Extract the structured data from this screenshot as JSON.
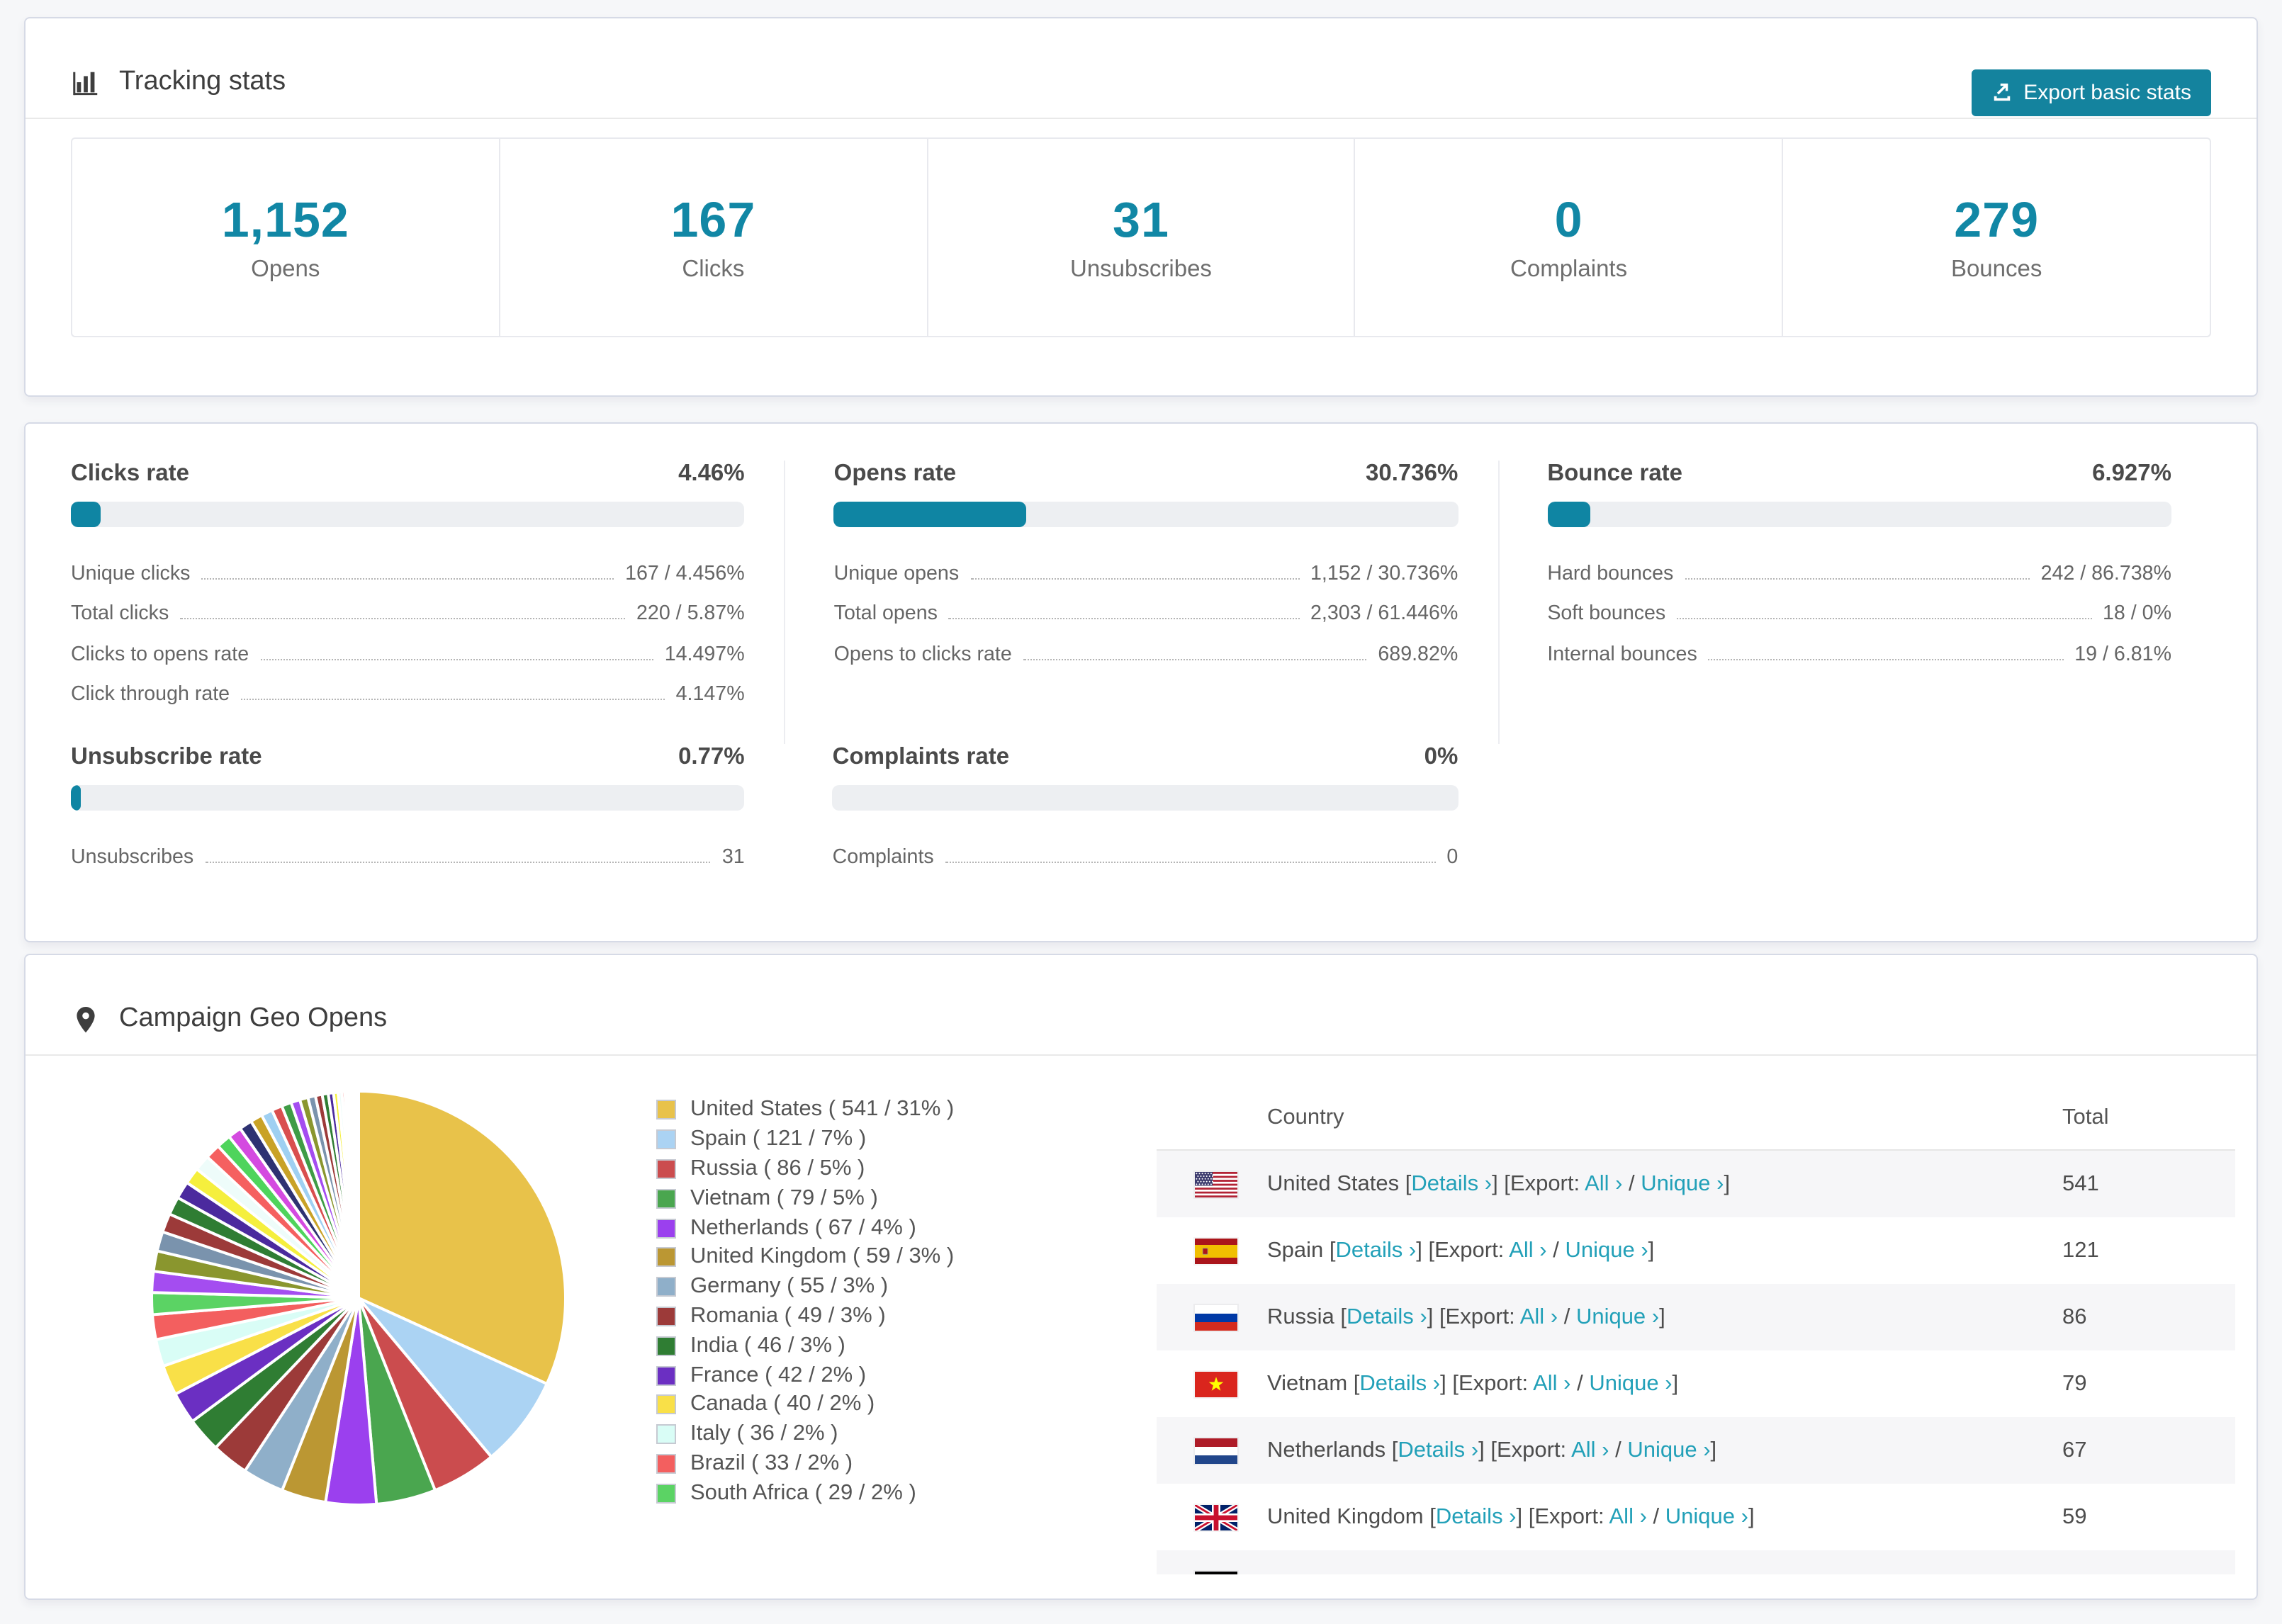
{
  "colors": {
    "accent_button": "#14839e",
    "accent_number": "#1187a5",
    "accent_bar": "#0f85a3",
    "accent_link": "#22a0b8",
    "page_background": "#f6f7f9"
  },
  "tracking": {
    "title": "Tracking stats",
    "export_button": "Export basic stats"
  },
  "summary_stats": [
    {
      "value": "1,152",
      "label": "Opens"
    },
    {
      "value": "167",
      "label": "Clicks"
    },
    {
      "value": "31",
      "label": "Unsubscribes"
    },
    {
      "value": "0",
      "label": "Complaints"
    },
    {
      "value": "279",
      "label": "Bounces"
    }
  ],
  "rates": [
    {
      "title": "Clicks rate",
      "value": "4.46%",
      "percent": 4.46,
      "rows": [
        {
          "label": "Unique clicks",
          "value": "167 / 4.456%"
        },
        {
          "label": "Total clicks",
          "value": "220 / 5.87%"
        },
        {
          "label": "Clicks to opens rate",
          "value": "14.497%"
        },
        {
          "label": "Click through rate",
          "value": "4.147%"
        }
      ]
    },
    {
      "title": "Opens rate",
      "value": "30.736%",
      "percent": 30.736,
      "rows": [
        {
          "label": "Unique opens",
          "value": "1,152 / 30.736%"
        },
        {
          "label": "Total opens",
          "value": "2,303 / 61.446%"
        },
        {
          "label": "Opens to clicks rate",
          "value": "689.82%"
        }
      ]
    },
    {
      "title": "Bounce rate",
      "value": "6.927%",
      "percent": 6.927,
      "rows": [
        {
          "label": "Hard bounces",
          "value": "242 / 86.738%"
        },
        {
          "label": "Soft bounces",
          "value": "18 / 0%"
        },
        {
          "label": "Internal bounces",
          "value": "19 / 6.81%"
        }
      ]
    },
    {
      "title": "Unsubscribe rate",
      "value": "0.77%",
      "percent": 0.77,
      "rows": [
        {
          "label": "Unsubscribes",
          "value": "31"
        }
      ]
    },
    {
      "title": "Complaints rate",
      "value": "0%",
      "percent": 0,
      "rows": [
        {
          "label": "Complaints",
          "value": "0"
        }
      ]
    }
  ],
  "geo": {
    "title": "Campaign Geo Opens",
    "table": {
      "columns": [
        "Country",
        "Total"
      ],
      "links": {
        "details": "Details ›",
        "export_prefix": "Export:",
        "all": "All ›",
        "unique": "Unique ›"
      },
      "rows": [
        {
          "country": "United States",
          "flag": "us",
          "total": "541"
        },
        {
          "country": "Spain",
          "flag": "es",
          "total": "121"
        },
        {
          "country": "Russia",
          "flag": "ru",
          "total": "86"
        },
        {
          "country": "Vietnam",
          "flag": "vn",
          "total": "79"
        },
        {
          "country": "Netherlands",
          "flag": "nl",
          "total": "67"
        },
        {
          "country": "United Kingdom",
          "flag": "gb",
          "total": "59"
        }
      ],
      "partial_row": {
        "flag": "de"
      }
    },
    "chart_data": {
      "type": "pie",
      "title": "Campaign Geo Opens",
      "legend_position": "right-of-pie",
      "legend_label_format": "{name} ( {value} / {pct} )",
      "series": [
        {
          "name": "United States",
          "value": 541,
          "pct": "31%",
          "color": "#e8c24a"
        },
        {
          "name": "Spain",
          "value": 121,
          "pct": "7%",
          "color": "#abd3f3"
        },
        {
          "name": "Russia",
          "value": 86,
          "pct": "5%",
          "color": "#cb4c4e"
        },
        {
          "name": "Vietnam",
          "value": 79,
          "pct": "5%",
          "color": "#4aa64f"
        },
        {
          "name": "Netherlands",
          "value": 67,
          "pct": "4%",
          "color": "#9b40ee"
        },
        {
          "name": "United Kingdom",
          "value": 59,
          "pct": "3%",
          "color": "#bb9733"
        },
        {
          "name": "Germany",
          "value": 55,
          "pct": "3%",
          "color": "#8fafc9"
        },
        {
          "name": "Romania",
          "value": 49,
          "pct": "3%",
          "color": "#9c3a39"
        },
        {
          "name": "India",
          "value": 46,
          "pct": "3%",
          "color": "#2f7d33"
        },
        {
          "name": "France",
          "value": 42,
          "pct": "2%",
          "color": "#6b2fc2"
        },
        {
          "name": "Canada",
          "value": 40,
          "pct": "2%",
          "color": "#f9e048"
        },
        {
          "name": "Italy",
          "value": 36,
          "pct": "2%",
          "color": "#d9fdf6"
        },
        {
          "name": "Brazil",
          "value": 33,
          "pct": "2%",
          "color": "#f35f5f"
        },
        {
          "name": "South Africa",
          "value": 29,
          "pct": "2%",
          "color": "#5bd364"
        }
      ],
      "others_tail": {
        "approx_slice_count": 40,
        "max_value": 28,
        "min_value": 1,
        "palette": [
          "#a44df0",
          "#8a962e",
          "#7a93ad",
          "#9c3a39",
          "#2f7d33",
          "#4b2a9e",
          "#f5ef3d",
          "#eefcfa",
          "#f56060",
          "#4fd45c",
          "#d44ae0",
          "#2e3272",
          "#c9a227",
          "#9fd0f2",
          "#d94f4f",
          "#3f9c46"
        ]
      }
    }
  }
}
